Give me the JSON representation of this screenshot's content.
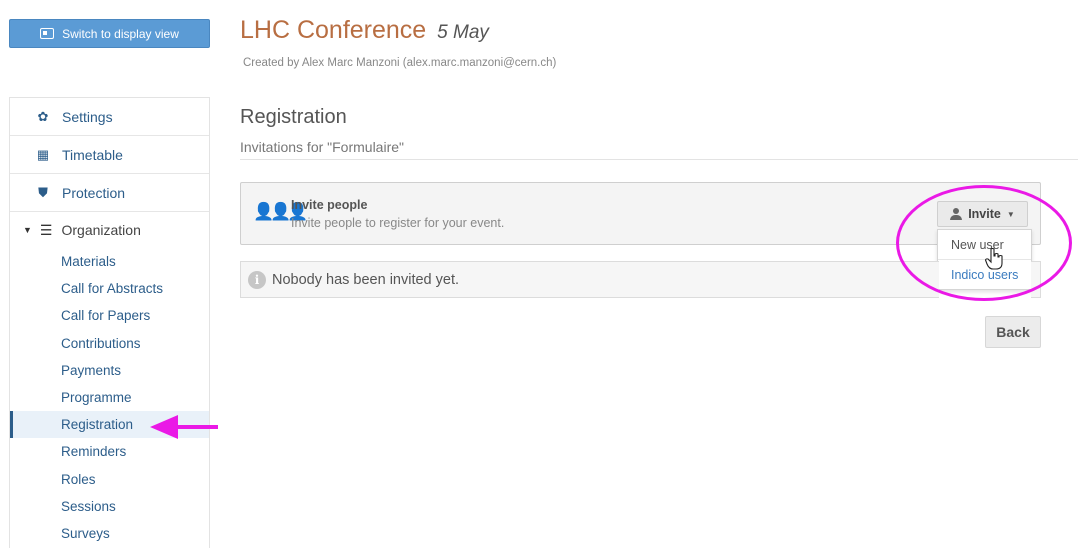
{
  "header": {
    "display_button_label": "Switch to display view",
    "event_title": "LHC Conference",
    "event_date": "5 May",
    "created_by": "Created by Alex Marc Manzoni (alex.marc.manzoni@cern.ch)"
  },
  "sidebar": {
    "top_items": [
      {
        "label": "Settings",
        "icon": "gear-icon"
      },
      {
        "label": "Timetable",
        "icon": "calendar-icon"
      },
      {
        "label": "Protection",
        "icon": "shield-icon"
      }
    ],
    "organization": {
      "label": "Organization",
      "icon": "list-icon",
      "items": [
        "Materials",
        "Call for Abstracts",
        "Call for Papers",
        "Contributions",
        "Payments",
        "Programme",
        "Registration",
        "Reminders",
        "Roles",
        "Sessions",
        "Surveys"
      ],
      "active": "Registration"
    }
  },
  "main": {
    "section_title": "Registration",
    "section_subtitle": "Invitations for \"Formulaire\"",
    "invite_box": {
      "title": "Invite people",
      "description": "Invite people to register for your event."
    },
    "invite_button_label": "Invite",
    "invite_menu": [
      "New user",
      "Indico users"
    ],
    "notice": "Nobody has been invited yet.",
    "back_button_label": "Back"
  },
  "annotations": {
    "highlight_color": "#ea19e6"
  },
  "colors": {
    "title": "#b86e42",
    "link": "#2c5d8a",
    "primary_button": "#5b9bd5"
  }
}
